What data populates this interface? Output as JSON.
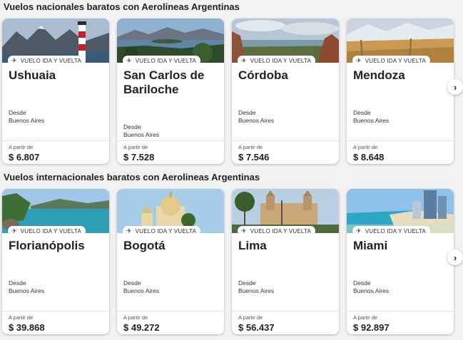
{
  "sections": [
    {
      "title": "Vuelos nacionales baratos con Aerolineas Argentinas",
      "cards": [
        {
          "city": "Ushuaia",
          "badge": "VUELO IDA Y VUELTA",
          "from_label": "Desde",
          "from_city": "Buenos Aires",
          "price_label": "A partir de",
          "price": "$ 6.807"
        },
        {
          "city": "San Carlos de Bariloche",
          "badge": "VUELO IDA Y VUELTA",
          "from_label": "Desde",
          "from_city": "Buenos Aires",
          "price_label": "A partir de",
          "price": "$ 7.528"
        },
        {
          "city": "Córdoba",
          "badge": "VUELO IDA Y VUELTA",
          "from_label": "Desde",
          "from_city": "Buenos Aires",
          "price_label": "A partir de",
          "price": "$ 7.546"
        },
        {
          "city": "Mendoza",
          "badge": "VUELO IDA Y VUELTA",
          "from_label": "Desde",
          "from_city": "Buenos Aires",
          "price_label": "A partir de",
          "price": "$ 8.648"
        }
      ]
    },
    {
      "title": "Vuelos internacionales baratos con Aerolineas Argentinas",
      "cards": [
        {
          "city": "Florianópolis",
          "badge": "VUELO IDA Y VUELTA",
          "from_label": "Desde",
          "from_city": "Buenos Aires",
          "price_label": "A partir de",
          "price": "$ 39.868"
        },
        {
          "city": "Bogotá",
          "badge": "VUELO IDA Y VUELTA",
          "from_label": "Desde",
          "from_city": "Buenos Aires",
          "price_label": "A partir de",
          "price": "$ 49.272"
        },
        {
          "city": "Lima",
          "badge": "VUELO IDA Y VUELTA",
          "from_label": "Desde",
          "from_city": "Buenos Aires",
          "price_label": "A partir de",
          "price": "$ 56.437"
        },
        {
          "city": "Miami",
          "badge": "VUELO IDA Y VUELTA",
          "from_label": "Desde",
          "from_city": "Buenos Aires",
          "price_label": "A partir de",
          "price": "$ 92.897"
        }
      ]
    }
  ],
  "icons": {
    "badge": "plane-icon",
    "next": "chevron-right-icon",
    "next_glyph": "›"
  }
}
